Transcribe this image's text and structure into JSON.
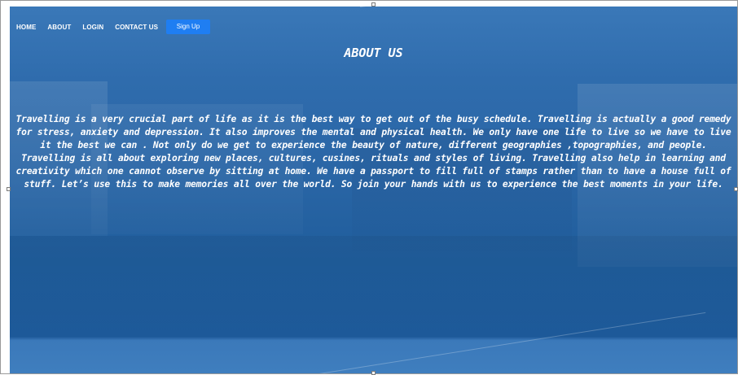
{
  "nav": {
    "items": [
      {
        "label": "HOME"
      },
      {
        "label": "ABOUT"
      },
      {
        "label": "LOGIN"
      },
      {
        "label": "CONTACT US"
      }
    ],
    "signup_label": "Sign Up"
  },
  "main": {
    "title": "ABOUT US",
    "paragraph": "Travelling is a very crucial part of life as it is the best way to get out of the busy schedule. Travelling is actually a good remedy for stress, anxiety and depression. It also improves the mental and physical health. We only have one life to live so we have to live it the best we can . Not only do we get to experience the beauty of nature, different geographies ,topographies, and people. Travelling is all about exploring new places, cultures, cusines, rituals and styles of living. Travelling also help in learning and creativity which one cannot observe by sitting at home. We have a passport to fill full of stamps rather than to have a house full of stuff. Let’s use this to make memories all over the world. So join your hands with us to experience the best moments in your life."
  },
  "colors": {
    "background": "#2f6cad",
    "signup_button": "#1f7ef2",
    "text": "#ffffff"
  }
}
